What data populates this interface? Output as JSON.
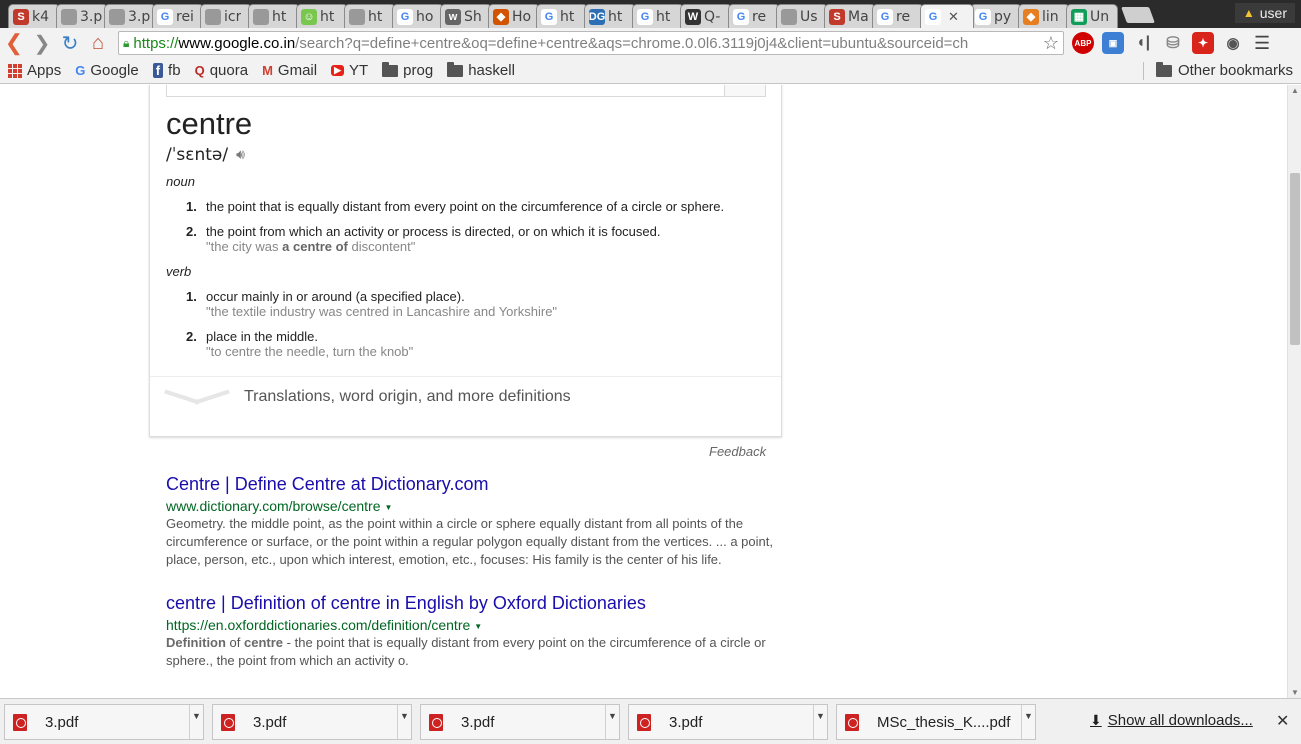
{
  "tabs": [
    {
      "title": "k4",
      "icon": "S",
      "color": "#c0392b"
    },
    {
      "title": "3.p",
      "icon": "",
      "color": "#999999"
    },
    {
      "title": "3.p",
      "icon": "",
      "color": "#999999"
    },
    {
      "title": "rei",
      "icon": "G",
      "color": "#4285f4"
    },
    {
      "title": "icr",
      "icon": "",
      "color": "#999999"
    },
    {
      "title": "ht",
      "icon": "",
      "color": "#999999"
    },
    {
      "title": "ht",
      "icon": "☺",
      "color": "#7ac74f"
    },
    {
      "title": "ht",
      "icon": "",
      "color": "#999999"
    },
    {
      "title": "ho",
      "icon": "G",
      "color": "#4285f4"
    },
    {
      "title": "Sh",
      "icon": "w",
      "color": "#666666"
    },
    {
      "title": "Ho",
      "icon": "◆",
      "color": "#d35400"
    },
    {
      "title": "ht",
      "icon": "G",
      "color": "#4285f4"
    },
    {
      "title": "ht",
      "icon": "DG",
      "color": "#2c6fb5"
    },
    {
      "title": "ht",
      "icon": "G",
      "color": "#4285f4"
    },
    {
      "title": "Q-",
      "icon": "W",
      "color": "#333333"
    },
    {
      "title": "re",
      "icon": "G",
      "color": "#4285f4"
    },
    {
      "title": "Us",
      "icon": "",
      "color": "#999999"
    },
    {
      "title": "Ma",
      "icon": "S",
      "color": "#c0392b"
    },
    {
      "title": "re",
      "icon": "G",
      "color": "#4285f4"
    },
    {
      "title": "",
      "icon": "G",
      "color": "#4285f4",
      "active": true
    },
    {
      "title": "py",
      "icon": "G",
      "color": "#4285f4"
    },
    {
      "title": "lin",
      "icon": "◆",
      "color": "#e67e22"
    },
    {
      "title": "Un",
      "icon": "▦",
      "color": "#0f9d58"
    }
  ],
  "profile": {
    "name": "user"
  },
  "omnibox": {
    "scheme": "https://",
    "host": "www.google.co.in",
    "rest": "/search?q=define+centre&oq=define+centre&aqs=chrome.0.0l6.3119j0j4&client=ubuntu&sourceid=ch"
  },
  "bookmarks": {
    "items": [
      {
        "label": "Apps"
      },
      {
        "label": "Google",
        "icon": "G",
        "color": "#4285f4"
      },
      {
        "label": "fb",
        "icon": "f",
        "color": "#3b5998"
      },
      {
        "label": "quora",
        "icon": "Q",
        "color": "#b92b27"
      },
      {
        "label": "Gmail",
        "icon": "M",
        "color": "#d23f31"
      },
      {
        "label": "YT",
        "icon": "▶",
        "color": "#e62117"
      },
      {
        "label": "prog"
      },
      {
        "label": "haskell"
      }
    ],
    "other": "Other bookmarks"
  },
  "dictionary": {
    "word": "centre",
    "phonetic": "/ˈsɛntə/",
    "noun_label": "noun",
    "verb_label": "verb",
    "noun_senses": [
      {
        "num": "1.",
        "def": "the point that is equally distant from every point on the circumference of a circle or sphere.",
        "example": ""
      },
      {
        "num": "2.",
        "def": "the point from which an activity or process is directed, or on which it is focused.",
        "ex_pre": "\"the city was ",
        "ex_bold": "a centre of",
        "ex_post": " discontent\""
      }
    ],
    "verb_senses": [
      {
        "num": "1.",
        "def": "occur mainly in or around (a specified place).",
        "example": "\"the textile industry was centred in Lancashire and Yorkshire\""
      },
      {
        "num": "2.",
        "def": "place in the middle.",
        "example": "\"to centre the needle, turn the knob\""
      }
    ],
    "more_label": "Translations, word origin, and more definitions",
    "feedback": "Feedback"
  },
  "results": [
    {
      "title": "Centre | Define Centre at Dictionary.com",
      "url": "www.dictionary.com/browse/centre",
      "snippet": "Geometry. the middle point, as the point within a circle or sphere equally distant from all points of the circumference or surface, or the point within a regular polygon equally distant from the vertices. ... a point, place, person, etc., upon which interest, emotion, etc., focuses: His family is the center of his life."
    },
    {
      "title": "centre | Definition of centre in English by Oxford Dictionaries",
      "url": "https://en.oxforddictionaries.com/definition/centre",
      "snip_b1": "Definition",
      "snip_t1": " of ",
      "snip_b2": "centre",
      "snip_t2": " - the point that is equally distant from every point on the circumference of a circle or sphere., the point from which an activity o."
    }
  ],
  "downloads": {
    "items": [
      {
        "name": "3.pdf"
      },
      {
        "name": "3.pdf"
      },
      {
        "name": "3.pdf"
      },
      {
        "name": "3.pdf"
      },
      {
        "name": "MSc_thesis_K....pdf"
      }
    ],
    "show_all": "Show all downloads..."
  }
}
